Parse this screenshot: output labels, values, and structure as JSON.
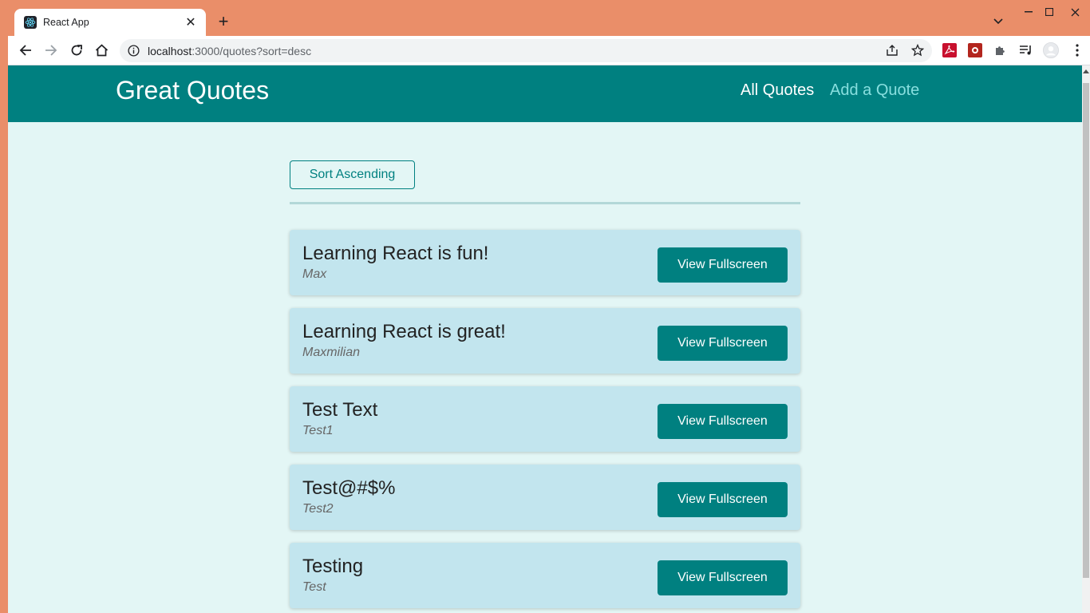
{
  "browser": {
    "tab_title": "React App",
    "url_host": "localhost",
    "url_rest": ":3000/quotes?sort=desc"
  },
  "header": {
    "logo": "Great Quotes",
    "nav": [
      {
        "label": "All Quotes",
        "active": true
      },
      {
        "label": "Add a Quote",
        "active": false
      }
    ]
  },
  "sort_button": "Sort Ascending",
  "quotes": [
    {
      "text": "Learning React is fun!",
      "author": "Max",
      "button": "View Fullscreen"
    },
    {
      "text": "Learning React is great!",
      "author": "Maxmilian",
      "button": "View Fullscreen"
    },
    {
      "text": "Test Text",
      "author": "Test1",
      "button": "View Fullscreen"
    },
    {
      "text": "Test@#$%",
      "author": "Test2",
      "button": "View Fullscreen"
    },
    {
      "text": "Testing",
      "author": "Test",
      "button": "View Fullscreen"
    }
  ],
  "colors": {
    "brand": "#008080",
    "page_bg": "#e3f6f5",
    "card_bg": "#c2e5ee",
    "nav_inactive": "#88dfdf",
    "browser_frame": "#ea8e69"
  },
  "icons": [
    "react-favicon-icon",
    "close-icon",
    "plus-icon",
    "chevron-down-icon",
    "minimize-icon",
    "maximize-icon",
    "window-close-icon",
    "back-arrow-icon",
    "forward-arrow-icon",
    "reload-icon",
    "home-icon",
    "info-icon",
    "share-icon",
    "star-icon",
    "pdf-extension-icon",
    "image-extension-icon",
    "puzzle-icon",
    "media-icon",
    "profile-icon",
    "kebab-menu-icon"
  ]
}
